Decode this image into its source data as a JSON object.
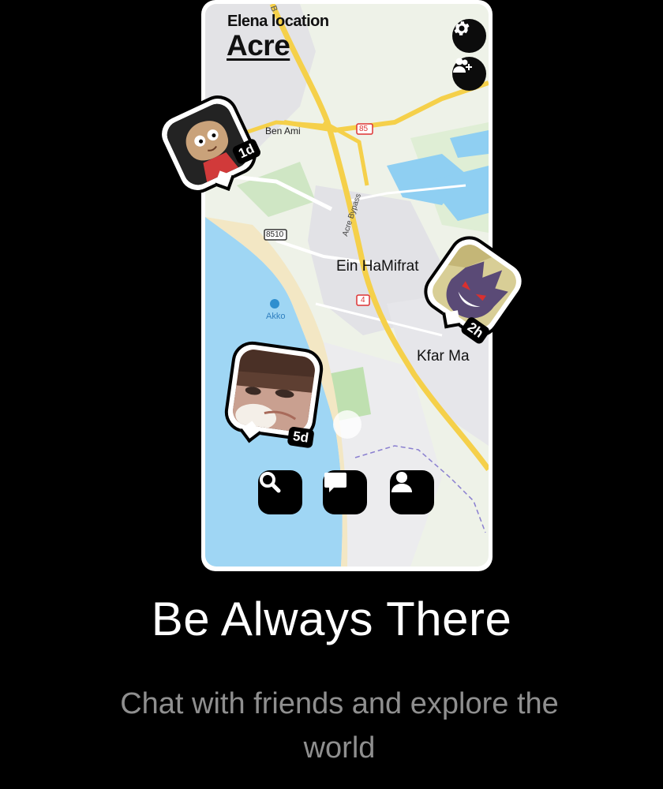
{
  "header": {
    "subtitle": "Elena location",
    "city": "Acre"
  },
  "controls": {
    "settings_icon": "gear-icon",
    "add_friend_icon": "add-friend-icon"
  },
  "map": {
    "labels": {
      "ben_ami": "Ben Ami",
      "road_85": "85",
      "acre_bypass": "Acre Bypass",
      "road_8510": "8510",
      "ein_hamifrat": "Ein HaMifrat",
      "road_4": "4",
      "akko": "Akko",
      "kfar_masaryk": "Kfar Ma",
      "bypass_top": "B"
    }
  },
  "friends": [
    {
      "name": "stewie-avatar",
      "badge": "1d"
    },
    {
      "name": "gengar-avatar",
      "badge": "2h"
    },
    {
      "name": "girl-avatar",
      "badge": "5d"
    }
  ],
  "nav": {
    "search_icon": "search-icon",
    "chat_icon": "chat-icon",
    "profile_icon": "profile-icon"
  },
  "headline": "Be Always There",
  "subline": "Chat with friends and explore the world",
  "colors": {
    "sea": "#9fd6f4",
    "land": "#eaf0e5",
    "highway": "#f5d04a",
    "background": "#000000"
  }
}
